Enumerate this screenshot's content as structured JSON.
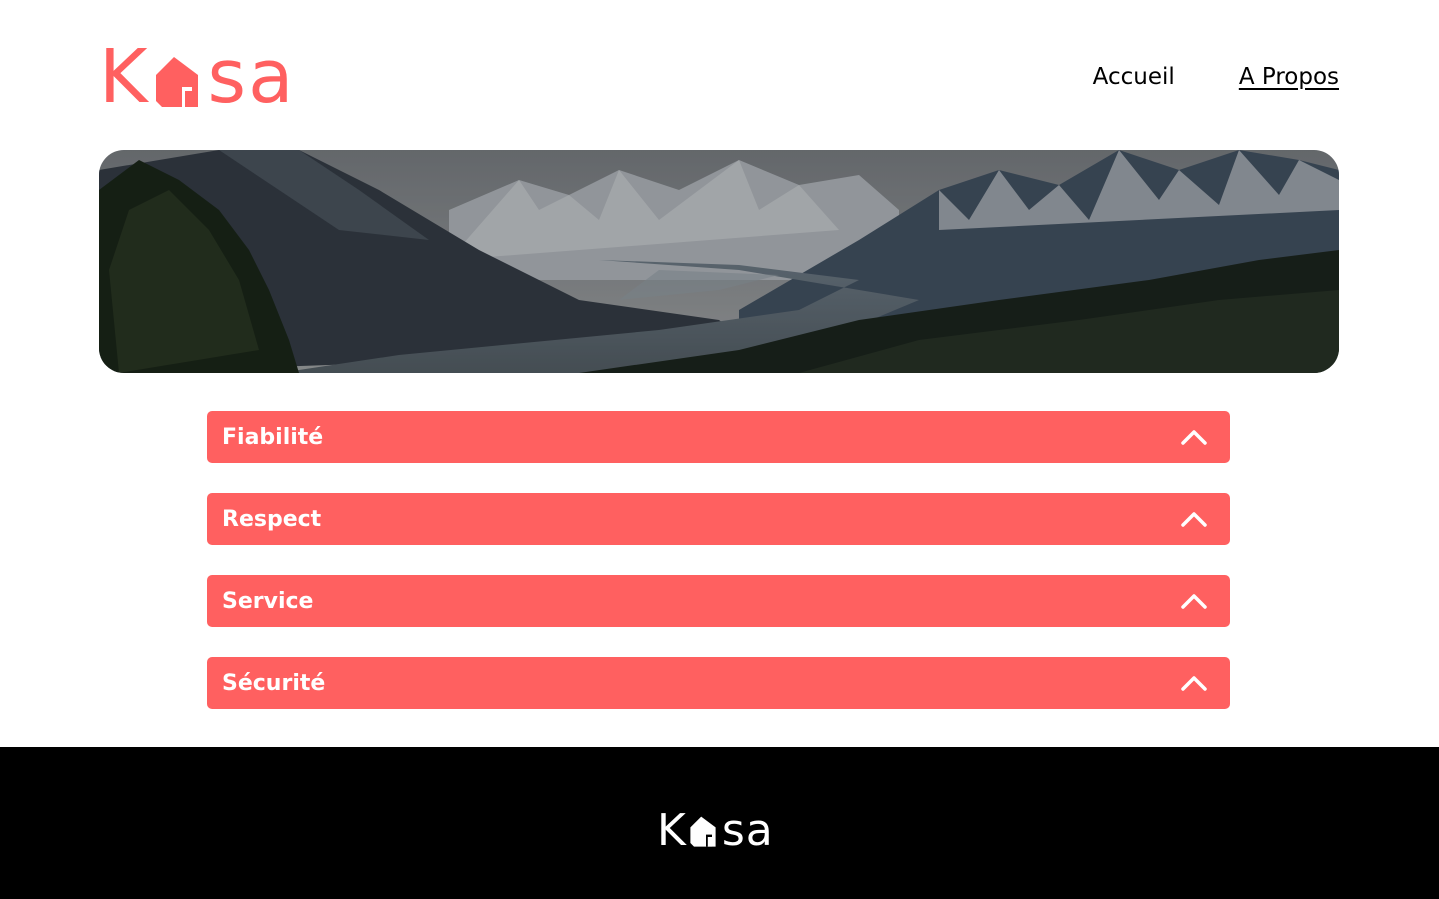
{
  "brand": {
    "logo_text_start": "K",
    "logo_text_end": "sa",
    "logo_icon": "house-icon",
    "accent_color": "#FF6060"
  },
  "nav": {
    "items": [
      {
        "label": "Accueil"
      },
      {
        "label": "A Propos"
      }
    ]
  },
  "banner": {
    "image": "mountain-valley-landscape"
  },
  "collapses": [
    {
      "title": "Fiabilité",
      "icon": "chevron-up-icon"
    },
    {
      "title": "Respect",
      "icon": "chevron-up-icon"
    },
    {
      "title": "Service",
      "icon": "chevron-up-icon"
    },
    {
      "title": "Sécurité",
      "icon": "chevron-up-icon"
    }
  ],
  "footer": {
    "logo_text_start": "K",
    "logo_text_end": "sa",
    "logo_icon": "house-icon",
    "background": "#000000"
  }
}
